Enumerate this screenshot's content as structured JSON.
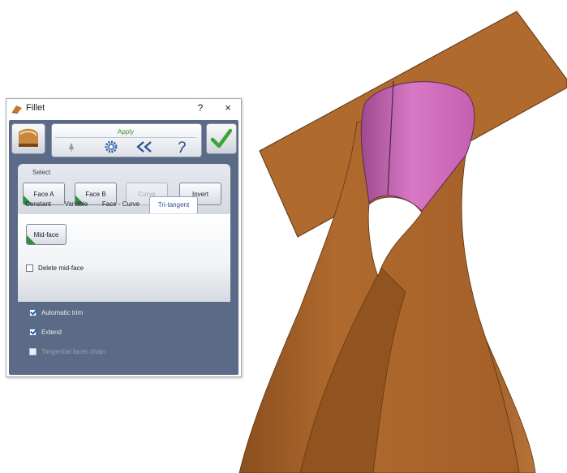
{
  "dialog": {
    "title": "Fillet",
    "help_label": "?",
    "close_label": "×",
    "toolbar": {
      "apply_label": "Apply",
      "icons": [
        "pin-icon",
        "gear-icon",
        "double-chevron-left-icon",
        "question-lasso-icon"
      ]
    },
    "confirm_icon": "green-checkmark-icon",
    "select": {
      "label": "Select",
      "buttons": [
        {
          "label": "Face A",
          "enabled": true
        },
        {
          "label": "Face B",
          "enabled": true
        },
        {
          "label": "Curve",
          "enabled": false
        },
        {
          "label": "Invert",
          "enabled": true
        }
      ]
    },
    "tabs": [
      {
        "label": "Constant"
      },
      {
        "label": "Variable"
      },
      {
        "label": "Face - Curve"
      },
      {
        "label": "Tri-tangent",
        "active": true
      }
    ],
    "tri_tangent": {
      "midface_label": "Mid-face",
      "delete_midface_label": "Delete mid-face",
      "delete_midface_checked": false
    },
    "options": [
      {
        "label": "Automatic trim",
        "checked": true,
        "enabled": true
      },
      {
        "label": "Extend",
        "checked": true,
        "enabled": true
      },
      {
        "label": "Tangential faces chain",
        "checked": false,
        "enabled": false
      }
    ]
  },
  "colors": {
    "surface_brown": "#b06a2e",
    "fillet_pink": "#d26bbd",
    "panel_blue": "#5b6a86",
    "accent_green": "#2f8f3f"
  }
}
